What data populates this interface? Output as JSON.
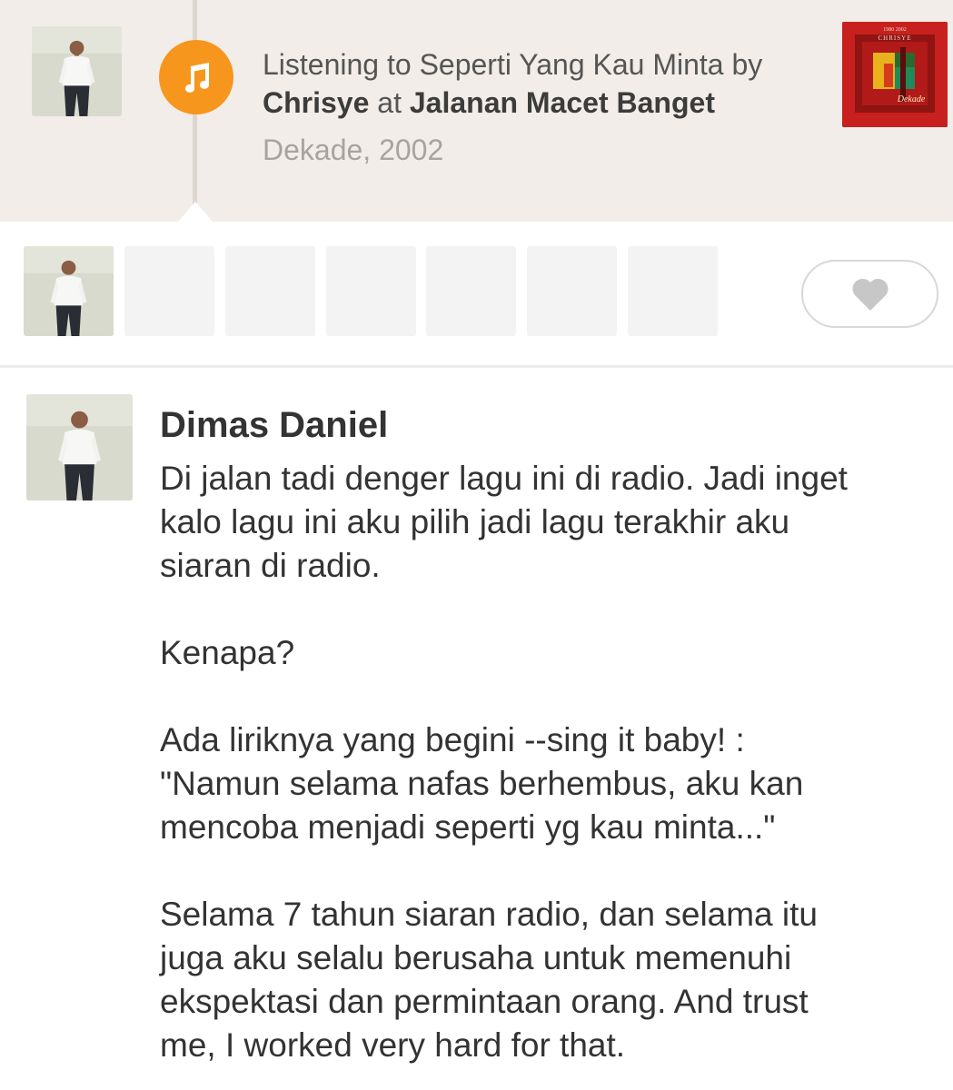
{
  "moment": {
    "prefix": "Listening to Seperti Yang Kau Minta by",
    "artist": "Chrisye",
    "at_word": "at",
    "location": "Jalanan Macet Banget",
    "album_info": "Dekade, 2002",
    "icon": "music-note-icon",
    "accent_color": "#f6961d",
    "album_art": {
      "title": "CHRISYE",
      "years": "1980  2002",
      "script": "Dekade",
      "color": "#c8201e"
    }
  },
  "likes": {
    "avatars_shown": 1,
    "placeholders": 6,
    "love_icon": "heart-icon"
  },
  "comment": {
    "author": "Dimas Daniel",
    "paragraphs": [
      [
        "Di jalan tadi denger lagu ini di radio. Jadi inget",
        "kalo lagu ini aku pilih jadi lagu terakhir aku",
        "siaran di radio."
      ],
      [
        "Kenapa?"
      ],
      [
        "Ada liriknya yang begini --sing it baby! :",
        "\"Namun selama nafas berhembus, aku kan",
        "mencoba menjadi seperti yg kau minta...\""
      ],
      [
        "Selama 7 tahun siaran radio, dan selama itu",
        "juga aku selalu berusaha untuk memenuhi",
        "ekspektasi dan permintaan orang. And trust",
        "me, I worked very hard for that."
      ]
    ]
  }
}
